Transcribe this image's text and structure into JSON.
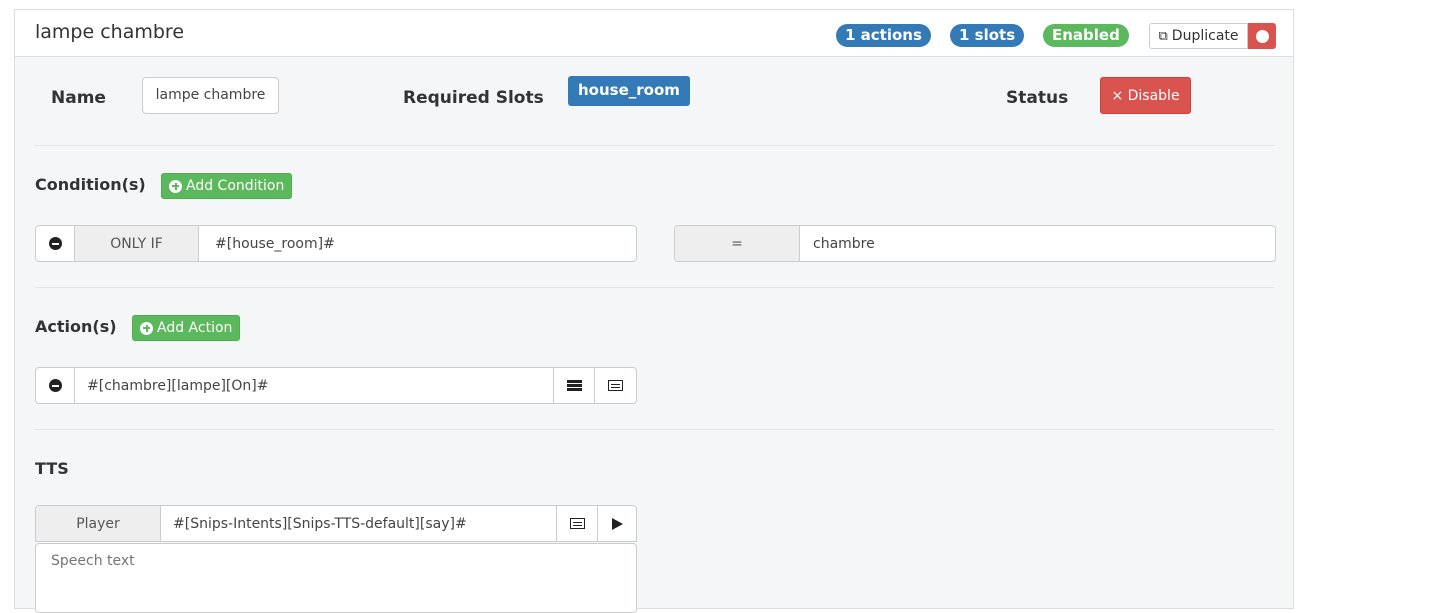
{
  "header": {
    "title": "lampe chambre",
    "badges": {
      "actions": "1 actions",
      "slots": "1 slots",
      "status": "Enabled"
    },
    "duplicate_label": "Duplicate"
  },
  "colors": {
    "primary": "#337ab7",
    "success": "#5cb85c",
    "danger": "#d9534f"
  },
  "info": {
    "name_label": "Name",
    "name_value": "lampe chambre",
    "slots_label": "Required Slots",
    "slots": [
      "house_room"
    ],
    "status_label": "Status",
    "disable_label": "× Disable"
  },
  "conditions": {
    "label": "Condition(s)",
    "add_label": "Add Condition",
    "items": [
      {
        "operator": "ONLY IF",
        "left": "#[house_room]#",
        "comparator": "=",
        "right": "chambre"
      }
    ]
  },
  "actions": {
    "label": "Action(s)",
    "add_label": "Add Action",
    "items": [
      {
        "command": "#[chambre][lampe][On]#"
      }
    ]
  },
  "tts": {
    "label": "TTS",
    "player_label": "Player",
    "player_value": "#[Snips-Intents][Snips-TTS-default][say]#",
    "speech_placeholder": "Speech text"
  }
}
